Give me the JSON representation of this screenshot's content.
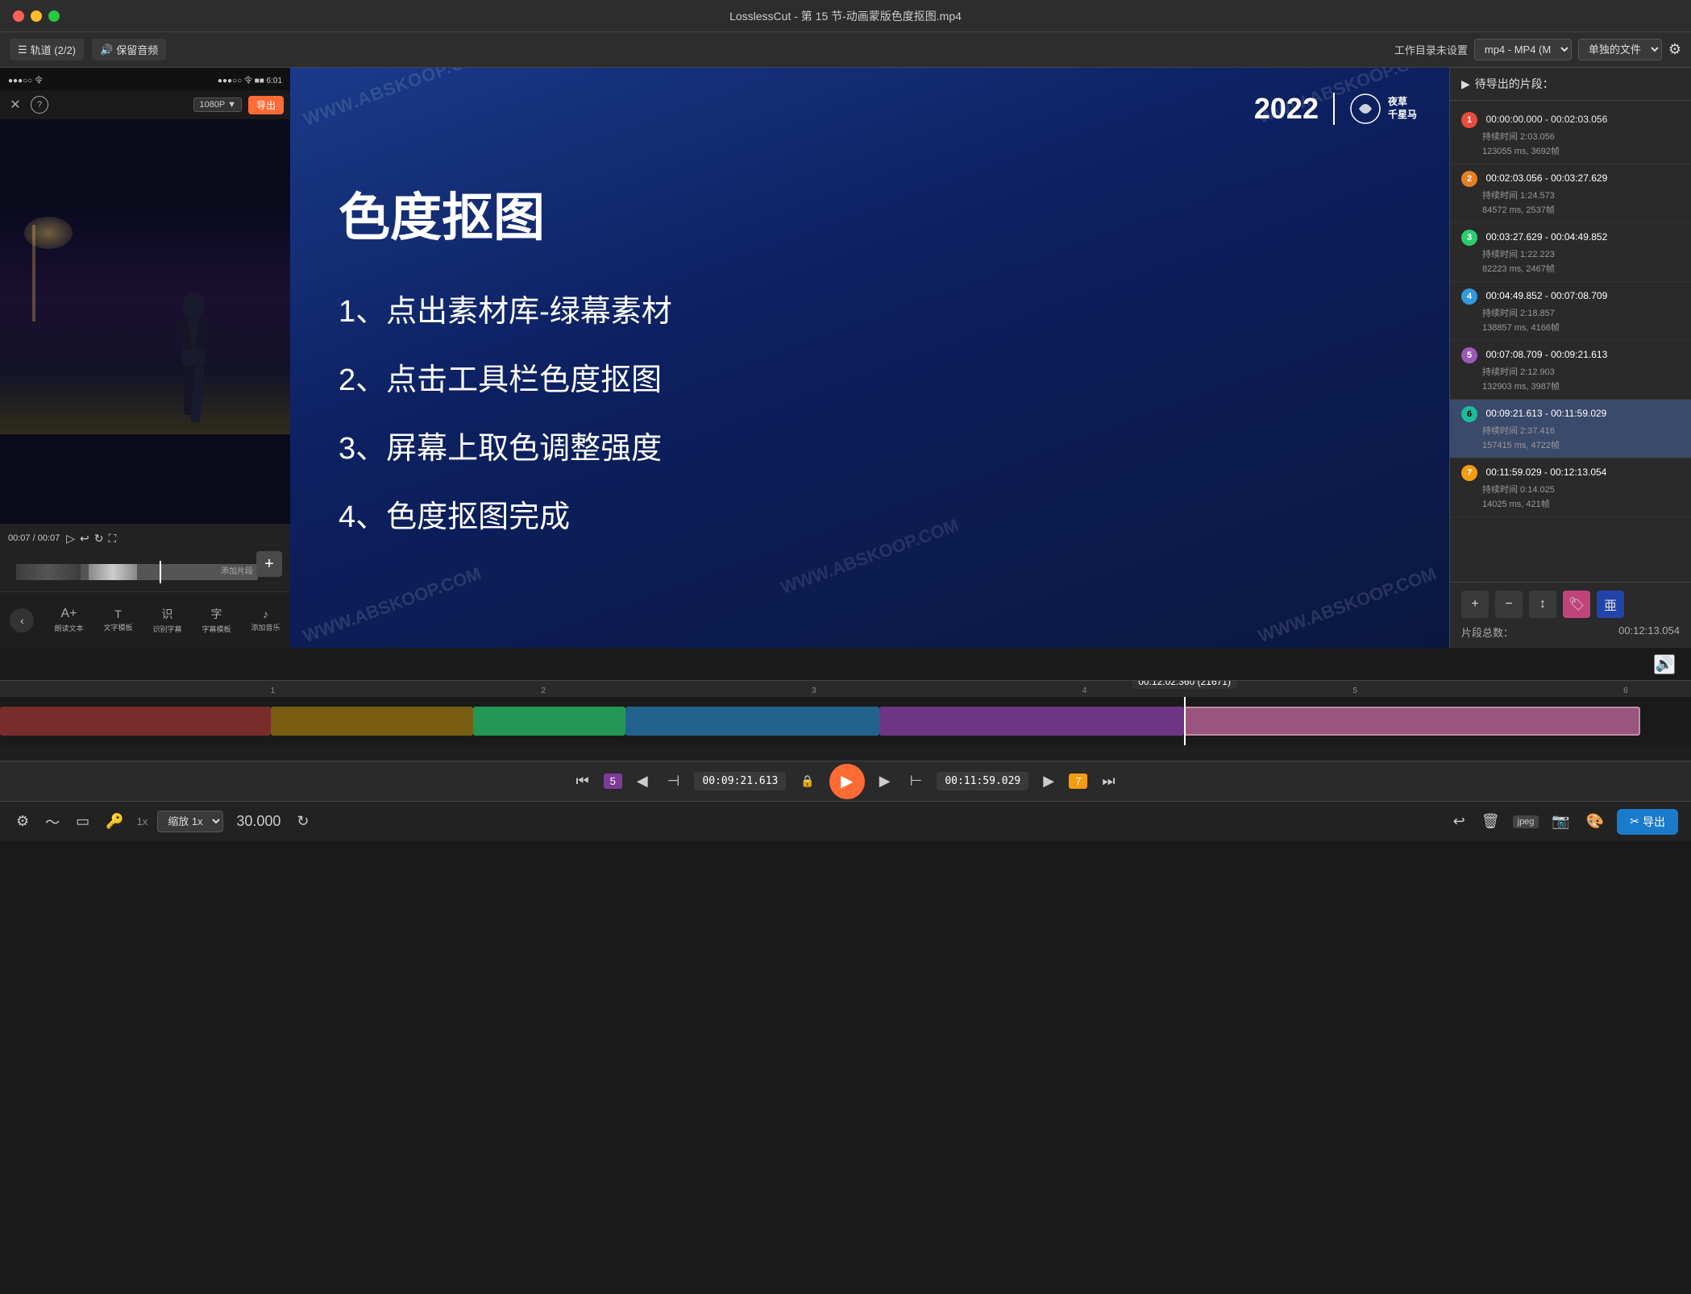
{
  "window": {
    "title": "LosslessCut - 第 15 节-动画蒙版色度抠图.mp4"
  },
  "toolbar": {
    "tracks_label": "轨道 (2/2)",
    "audio_label": "保留音频",
    "workdir_label": "工作目录未设置",
    "format_label": "mp4 - MP4 (M",
    "output_label": "单独的文件",
    "menu_icon": "☰",
    "speaker_icon": "🔊"
  },
  "segments": {
    "header": "待导出的片段：",
    "arrow_icon": "▶",
    "items": [
      {
        "num": "1",
        "color_class": "seg-1",
        "time": "00:00:00.000 - 00:02:03.056",
        "duration": "持续时间 2:03.056",
        "detail": "123055 ms, 3692帧"
      },
      {
        "num": "2",
        "color_class": "seg-2",
        "time": "00:02:03.056 - 00:03:27.629",
        "duration": "持续时间 1:24.573",
        "detail": "84572 ms, 2537帧"
      },
      {
        "num": "3",
        "color_class": "seg-3",
        "time": "00:03:27.629 - 00:04:49.852",
        "duration": "持续时间 1:22.223",
        "detail": "82223 ms, 2467帧"
      },
      {
        "num": "4",
        "color_class": "seg-4",
        "time": "00:04:49.852 - 00:07:08.709",
        "duration": "持续时间 2:18.857",
        "detail": "138857 ms, 4166帧"
      },
      {
        "num": "5",
        "color_class": "seg-5",
        "time": "00:07:08.709 - 00:09:21.613",
        "duration": "持续时间 2:12.903",
        "detail": "132903 ms, 3987帧"
      },
      {
        "num": "6",
        "color_class": "seg-6",
        "time": "00:09:21.613 - 00:11:59.029",
        "duration": "持续时间 2:37.416",
        "detail": "157415 ms, 4722帧"
      },
      {
        "num": "7",
        "color_class": "seg-7",
        "time": "00:11:59.029 - 00:12:13.054",
        "duration": "持续时间 0:14.025",
        "detail": "14025 ms, 421帧"
      }
    ],
    "total_label": "片段总数：",
    "total_time": "00:12:13.054",
    "actions": {
      "add": "+",
      "remove": "−",
      "reorder": "↕",
      "tag": "🏷",
      "convert": "亜"
    }
  },
  "slide": {
    "year": "2022",
    "brand": "夜草 千星马",
    "title": "色度抠图",
    "items": [
      "1、点出素材库-绿幕素材",
      "2、点击工具栏色度抠图",
      "3、屏幕上取色调整强度",
      "4、色度抠图完成"
    ],
    "watermarks": [
      "WWW.ABSKOOP.COM",
      "WWW.ABSKOOP.COM",
      "WWW.ABSKOOP.COM",
      "WWW.ABSKOOP.COM",
      "WWW.ABSKOOP.COM"
    ]
  },
  "phone": {
    "status_bar": "●●●○○ 令 ■■ 6:01",
    "resolution": "1080P ▼",
    "export_btn": "导出",
    "close_icon": "✕",
    "help_icon": "?",
    "time_display": "00:07 / 00:07",
    "add_clip_label": "添加片段"
  },
  "controls": {
    "time_start": "00:09:21.613",
    "time_end": "00:11:59.029",
    "timeline_pos": "00:12:02.360 (21671)",
    "seg_num_left": "5",
    "seg_num_right": "7",
    "play_icon": "▶",
    "prev_icon": "⏮",
    "next_icon": "⏭",
    "prev_seg": "◀",
    "next_seg": "▶",
    "frame_back": "◁",
    "frame_fwd": "▷",
    "set_start": "⊣",
    "set_end": "⊢",
    "lock_icon": "🔒",
    "unlock_icon": "🔓"
  },
  "status_bar": {
    "settings_icon": "⚙",
    "waveform_icon": "〜",
    "thumbnail_icon": "▭",
    "key_icon": "🔑",
    "zoom_label": "1x 缩放 1x ▼",
    "fps_label": "30.000",
    "refresh_icon": "↻",
    "undo_icon": "↩",
    "delete_icon": "🗑",
    "jpeg_label": "jpeg",
    "camera_icon": "📷",
    "palette_icon": "🎨",
    "export_icon": "✂ 导出"
  },
  "timeline": {
    "markers": [
      "1",
      "2",
      "3",
      "4",
      "5",
      "6"
    ],
    "segments": [
      {
        "color": "#e74c3c",
        "left": "0%",
        "width": "17%"
      },
      {
        "color": "#c0a020",
        "left": "17%",
        "width": "11%"
      },
      {
        "color": "#27ae60",
        "left": "28%",
        "width": "9%"
      },
      {
        "color": "#2980b9",
        "left": "37%",
        "width": "18%"
      },
      {
        "color": "#8e44ad",
        "left": "55%",
        "width": "18%"
      },
      {
        "color": "#c0748a",
        "left": "73%",
        "width": "26%"
      }
    ],
    "playhead_pos": "70%"
  }
}
